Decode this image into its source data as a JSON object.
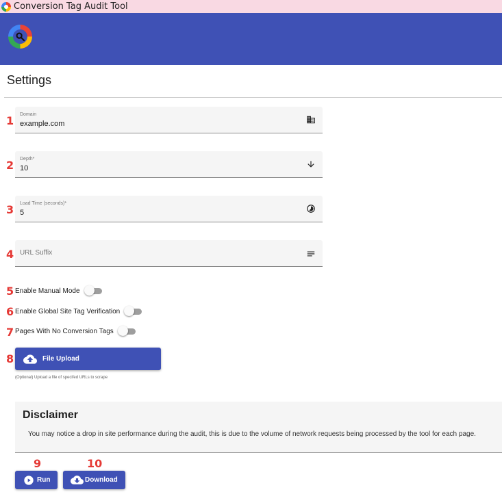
{
  "window": {
    "title": "Conversion Tag Audit Tool"
  },
  "page": {
    "title": "Settings"
  },
  "fields": {
    "domain": {
      "label": "Domain",
      "value": "example.com",
      "icon": "building-icon"
    },
    "depth": {
      "label": "Depth*",
      "value": "10",
      "icon": "arrow-down-icon"
    },
    "load_time": {
      "label": "Load Time (seconds)*",
      "value": "5",
      "icon": "timelapse-icon"
    },
    "url_suffix": {
      "placeholder": "URL Suffix",
      "value": "",
      "icon": "notes-icon"
    }
  },
  "toggles": {
    "manual_mode": {
      "label": "Enable Manual Mode",
      "on": false
    },
    "global_site_tag": {
      "label": "Enable Global Site Tag Verification",
      "on": false
    },
    "no_conversion_tags": {
      "label": "Pages With No Conversion Tags",
      "on": false
    }
  },
  "upload": {
    "label": "File Upload",
    "hint": "(Optional) Upload a file of specifed URLs to scrape"
  },
  "disclaimer": {
    "title": "Disclaimer",
    "text": "You may notice a drop in site performance during the audit, this is due to the volume of network requests being processed by the tool for each page."
  },
  "actions": {
    "run_label": "Run",
    "download_label": "Download"
  },
  "markers": [
    "1",
    "2",
    "3",
    "4",
    "5",
    "6",
    "7",
    "8",
    "9",
    "10"
  ],
  "colors": {
    "primary": "#3f51b5",
    "marker": "#e53935",
    "titlebar": "#f9d9e3"
  }
}
